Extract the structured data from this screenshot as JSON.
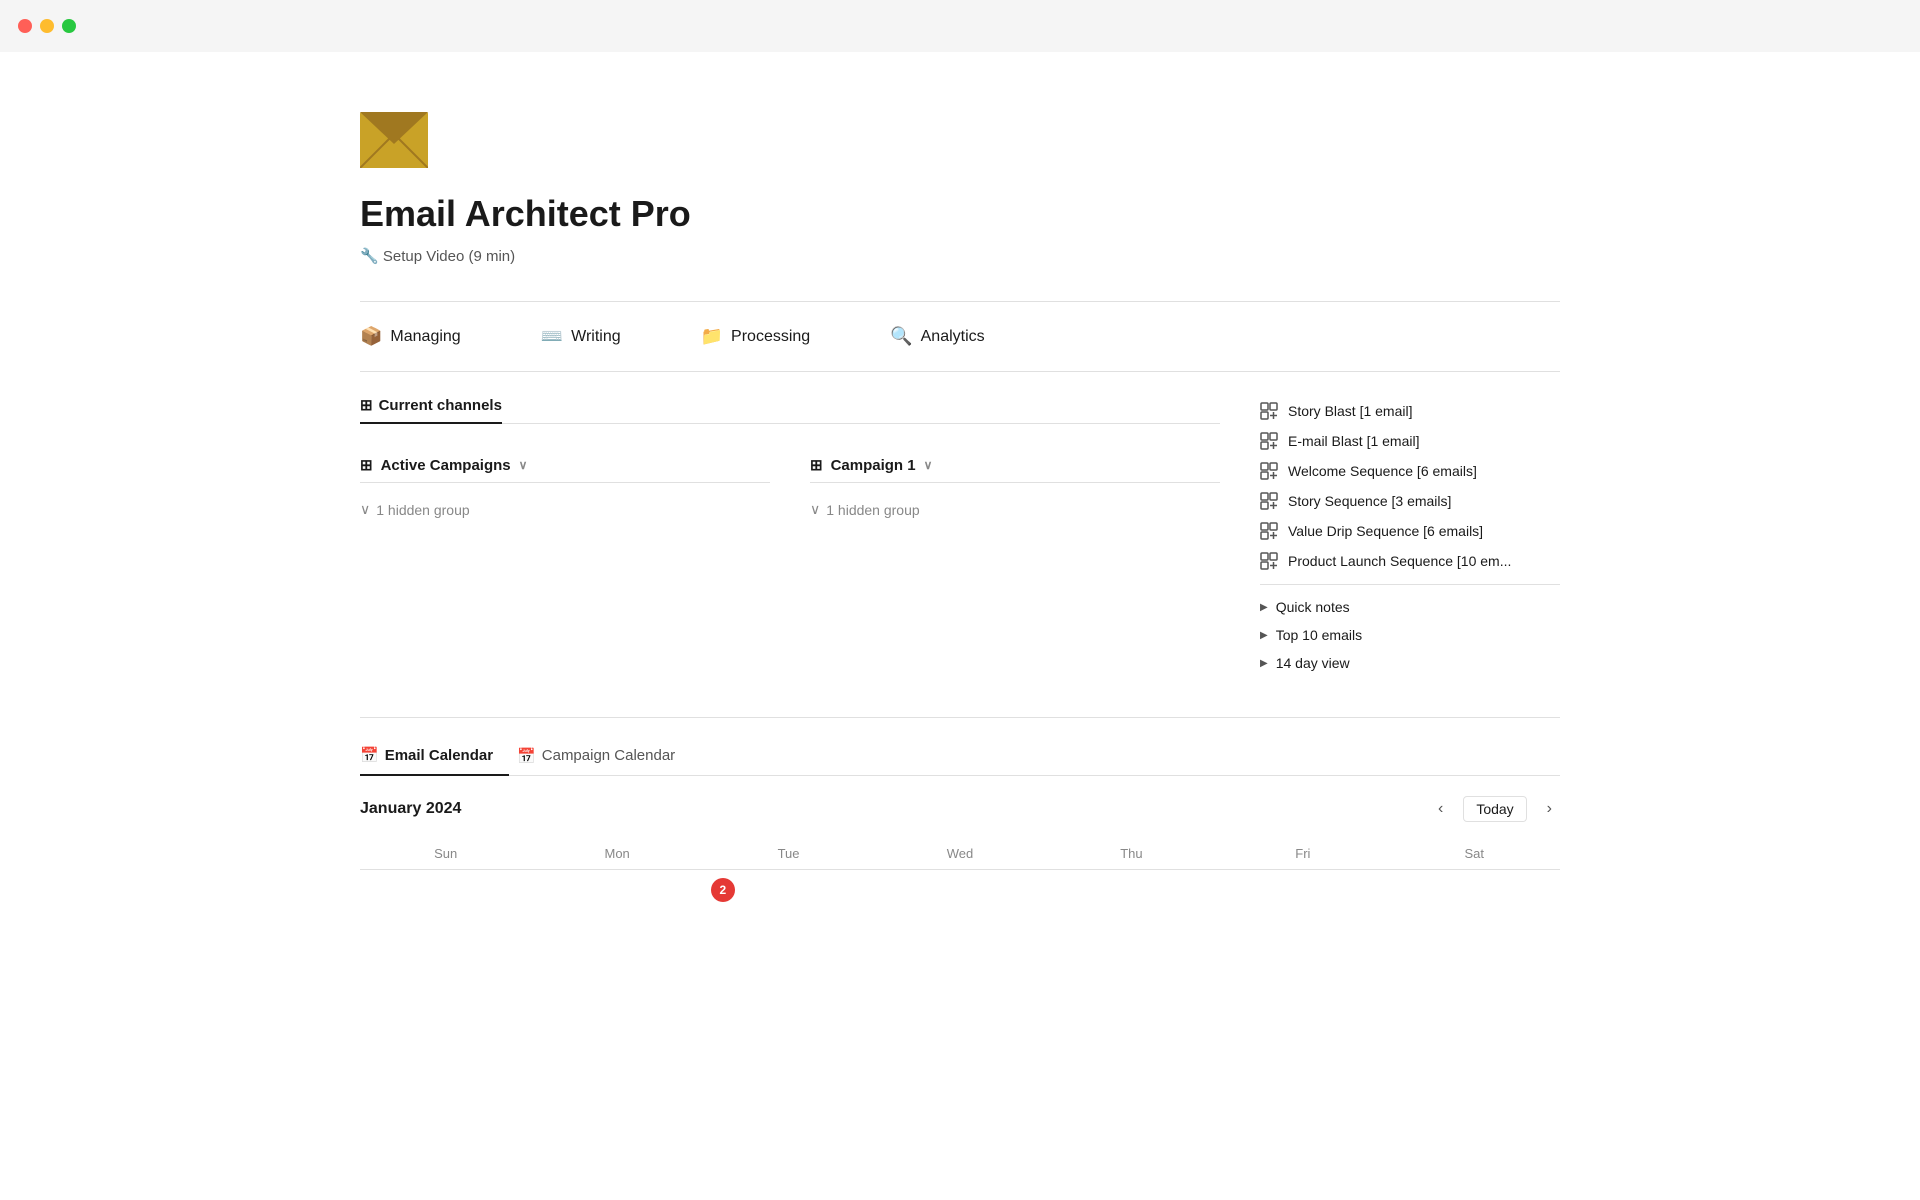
{
  "titlebar": {
    "traffic_lights": [
      "red",
      "yellow",
      "green"
    ]
  },
  "header": {
    "icon_label": "envelope",
    "title": "Email Architect Pro",
    "setup_link": "🔧 Setup Video (9 min)"
  },
  "nav": {
    "items": [
      {
        "id": "managing",
        "icon": "📦",
        "label": "Managing"
      },
      {
        "id": "writing",
        "icon": "⌨️",
        "label": "Writing"
      },
      {
        "id": "processing",
        "icon": "📁",
        "label": "Processing"
      },
      {
        "id": "analytics",
        "icon": "🔍",
        "label": "Analytics"
      }
    ]
  },
  "tabs": [
    {
      "id": "current-channels",
      "label": "Current channels",
      "active": true
    }
  ],
  "db_views": [
    {
      "id": "active-campaigns",
      "icon": "⊞",
      "label": "Active Campaigns",
      "hidden_group": "1 hidden group"
    },
    {
      "id": "campaign-1",
      "icon": "⊞",
      "label": "Campaign 1",
      "hidden_group": "1 hidden group"
    }
  ],
  "sidebar": {
    "items": [
      {
        "id": "story-blast",
        "label": "Story Blast [1 email]"
      },
      {
        "id": "email-blast",
        "label": "E-mail Blast [1 email]"
      },
      {
        "id": "welcome-sequence",
        "label": "Welcome Sequence [6 emails]"
      },
      {
        "id": "story-sequence",
        "label": "Story Sequence [3 emails]"
      },
      {
        "id": "value-drip",
        "label": "Value Drip Sequence [6 emails]"
      },
      {
        "id": "product-launch",
        "label": "Product Launch Sequence [10 em..."
      }
    ],
    "expandables": [
      {
        "id": "quick-notes",
        "label": "Quick notes"
      },
      {
        "id": "top-10-emails",
        "label": "Top 10 emails"
      },
      {
        "id": "14-day-view",
        "label": "14 day view"
      }
    ]
  },
  "calendar": {
    "tabs": [
      {
        "id": "email-calendar",
        "label": "Email Calendar",
        "active": true
      },
      {
        "id": "campaign-calendar",
        "label": "Campaign Calendar",
        "active": false
      }
    ],
    "month": "January 2024",
    "today_label": "Today",
    "days": [
      "Sun",
      "Mon",
      "Tue",
      "Wed",
      "Thu",
      "Fri",
      "Sat"
    ],
    "today_date": "2"
  }
}
